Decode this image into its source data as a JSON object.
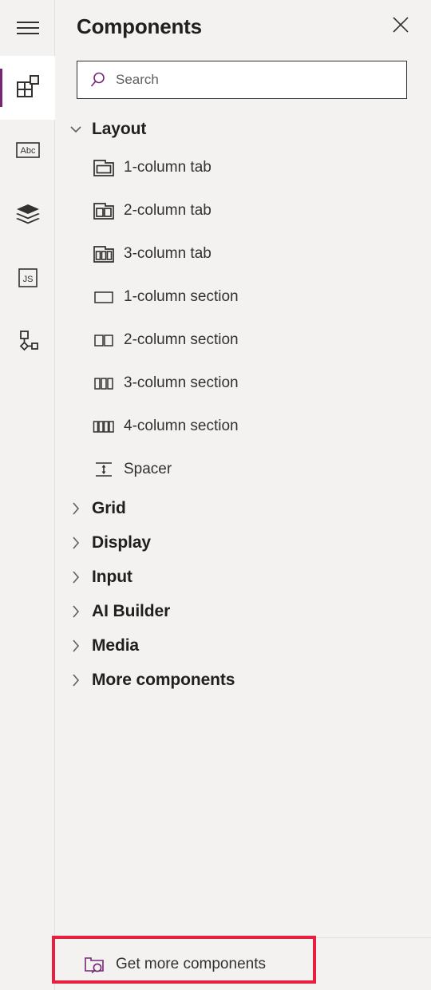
{
  "rail": {
    "menu_icon": "hamburger-menu-icon",
    "items": [
      {
        "name": "components",
        "icon": "components-grid-icon",
        "selected": true
      },
      {
        "name": "text",
        "icon": "abc-text-icon",
        "selected": false
      },
      {
        "name": "layers",
        "icon": "layers-stack-icon",
        "selected": false
      },
      {
        "name": "code",
        "icon": "js-code-icon",
        "selected": false
      },
      {
        "name": "flow",
        "icon": "node-tree-icon",
        "selected": false
      }
    ]
  },
  "header": {
    "title": "Components",
    "close_icon": "close-icon"
  },
  "search": {
    "placeholder": "Search",
    "value": "",
    "icon": "search-icon"
  },
  "tree": {
    "groups": [
      {
        "label": "Layout",
        "expanded": true,
        "chevron": "chevron-down-icon",
        "items": [
          {
            "label": "1-column tab",
            "icon": "one-column-tab-icon"
          },
          {
            "label": "2-column tab",
            "icon": "two-column-tab-icon"
          },
          {
            "label": "3-column tab",
            "icon": "three-column-tab-icon"
          },
          {
            "label": "1-column section",
            "icon": "one-column-section-icon"
          },
          {
            "label": "2-column section",
            "icon": "two-column-section-icon"
          },
          {
            "label": "3-column section",
            "icon": "three-column-section-icon"
          },
          {
            "label": "4-column section",
            "icon": "four-column-section-icon"
          },
          {
            "label": "Spacer",
            "icon": "spacer-icon"
          }
        ]
      },
      {
        "label": "Grid",
        "expanded": false,
        "chevron": "chevron-right-icon",
        "items": []
      },
      {
        "label": "Display",
        "expanded": false,
        "chevron": "chevron-right-icon",
        "items": []
      },
      {
        "label": "Input",
        "expanded": false,
        "chevron": "chevron-right-icon",
        "items": []
      },
      {
        "label": "AI Builder",
        "expanded": false,
        "chevron": "chevron-right-icon",
        "items": []
      },
      {
        "label": "Media",
        "expanded": false,
        "chevron": "chevron-right-icon",
        "items": []
      },
      {
        "label": "More components",
        "expanded": false,
        "chevron": "chevron-right-icon",
        "items": []
      }
    ]
  },
  "footer": {
    "label": "Get more components",
    "icon": "folder-search-icon"
  },
  "annotation": {
    "highlight_color": "#e81f3e",
    "target": "Get more components"
  },
  "colors": {
    "accent": "#742774",
    "panel_bg": "#f3f2f1",
    "selected_bg": "#ffffff",
    "text": "#201f1e",
    "divider": "#e1dfdd"
  }
}
